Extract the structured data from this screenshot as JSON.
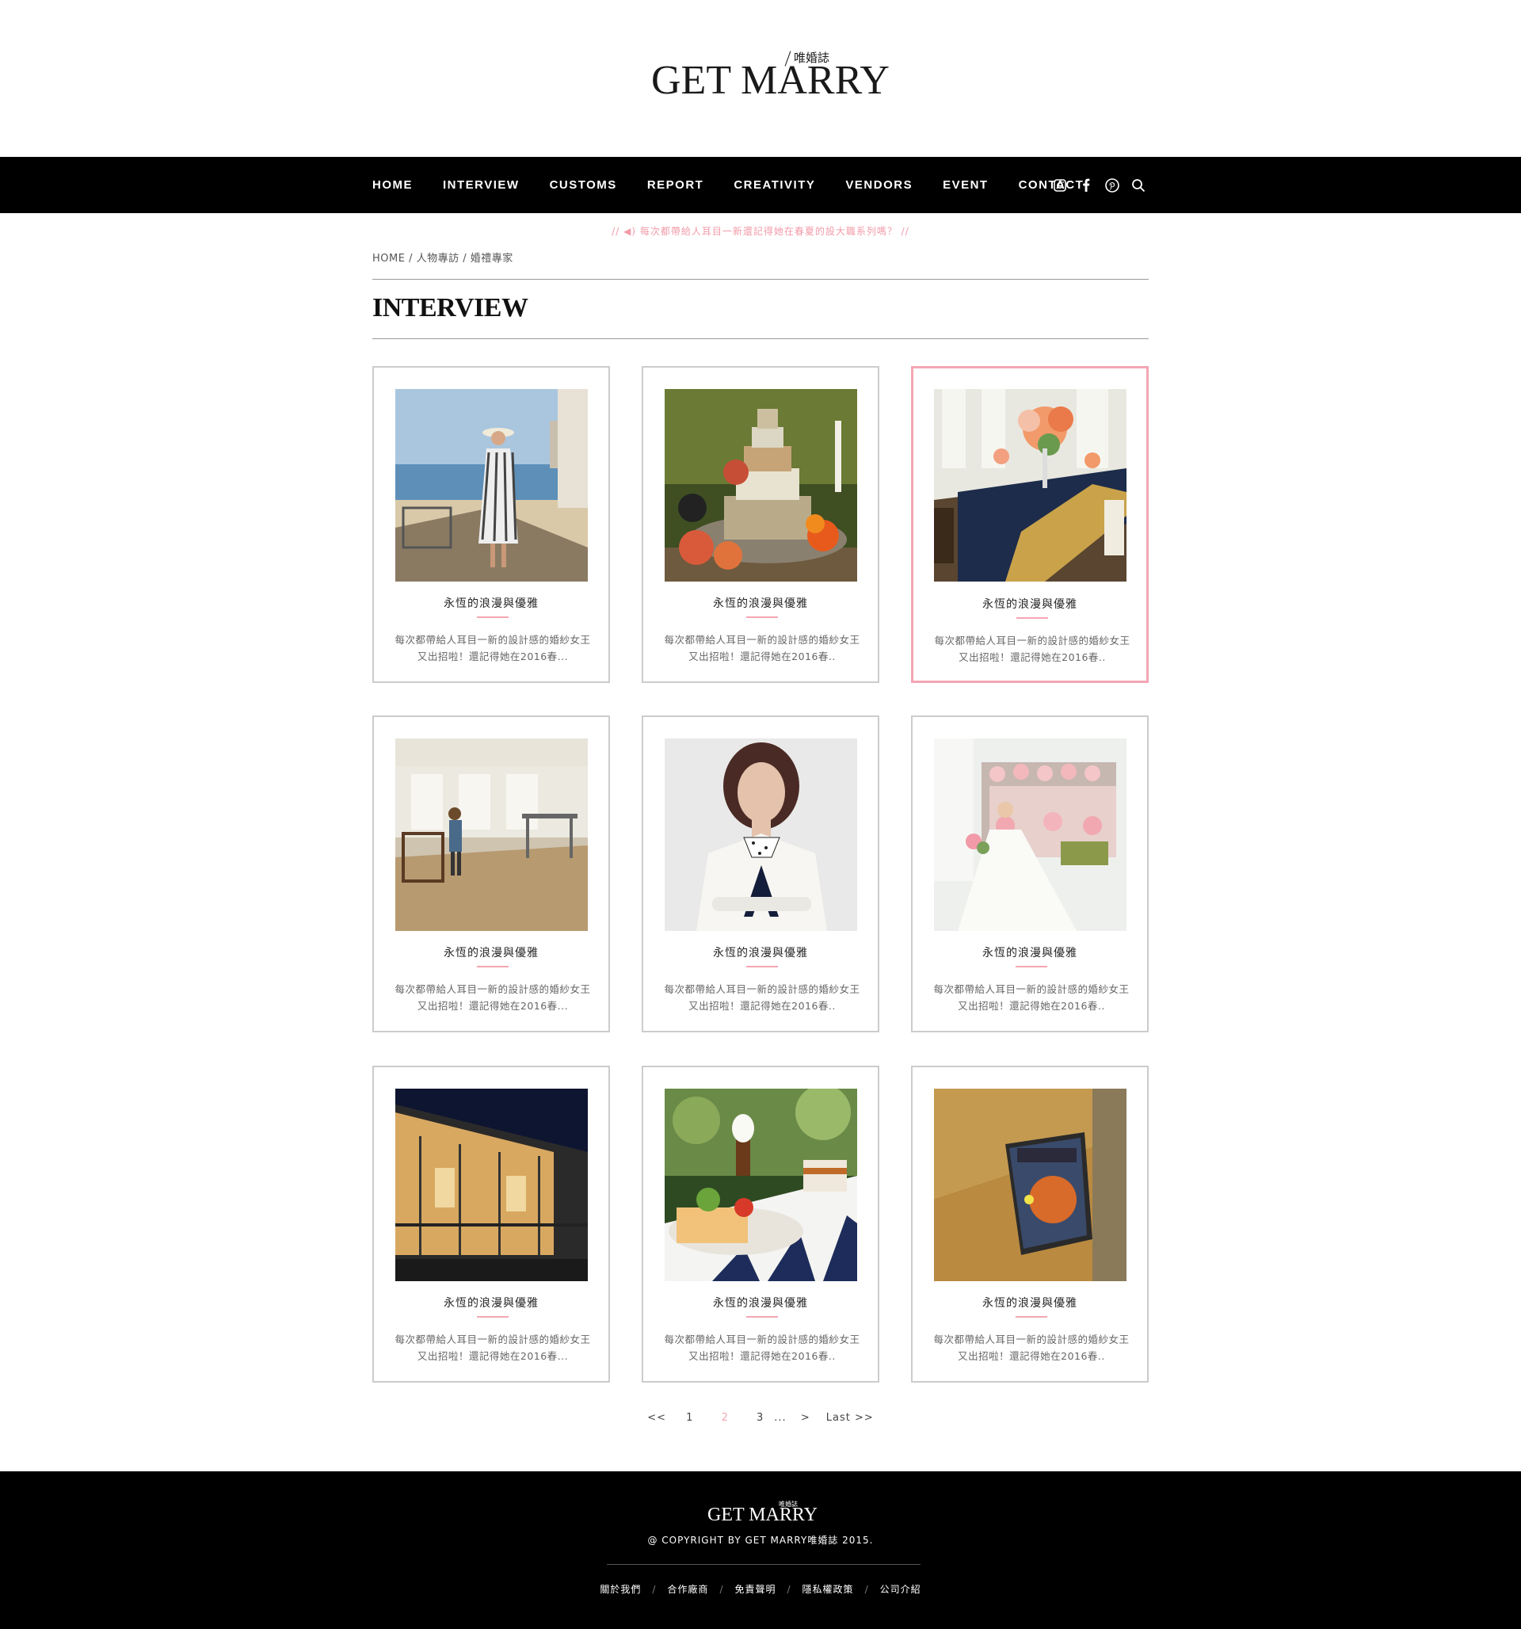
{
  "header": {
    "logo_main": "GET MARRY",
    "logo_sub": "唯婚誌"
  },
  "nav": {
    "items": [
      "HOME",
      "INTERVIEW",
      "CUSTOMS",
      "REPORT",
      "CREATIVITY",
      "VENDORS",
      "EVENT",
      "CONTACT"
    ],
    "icons": [
      "instagram-icon",
      "facebook-icon",
      "pinterest-icon",
      "search-icon"
    ]
  },
  "ticker": "// ◀) 每次都帶給人耳目一新還記得她在春夏的設大職系列嗎？ //",
  "breadcrumb": {
    "home": "HOME",
    "sep": " / ",
    "level1": "人物專訪",
    "level2": "婚禮專家"
  },
  "page_title": "INTERVIEW",
  "cards": [
    {
      "title": "永恆的浪漫與優雅",
      "desc1": "每次都帶給人耳目一新的設計感的婚紗女王",
      "desc2": "又出招啦！還記得她在2016春..."
    },
    {
      "title": "永恆的浪漫與優雅",
      "desc1": "每次都帶給人耳目一新的設計感的婚紗女王",
      "desc2": "又出招啦！還記得她在2016春.."
    },
    {
      "title": "永恆的浪漫與優雅",
      "desc1": "每次都帶給人耳目一新的設計感的婚紗女王",
      "desc2": "又出招啦！還記得她在2016春.."
    },
    {
      "title": "永恆的浪漫與優雅",
      "desc1": "每次都帶給人耳目一新的設計感的婚紗女王",
      "desc2": "又出招啦！還記得她在2016春..."
    },
    {
      "title": "永恆的浪漫與優雅",
      "desc1": "每次都帶給人耳目一新的設計感的婚紗女王",
      "desc2": "又出招啦！還記得她在2016春.."
    },
    {
      "title": "永恆的浪漫與優雅",
      "desc1": "每次都帶給人耳目一新的設計感的婚紗女王",
      "desc2": "又出招啦！還記得她在2016春.."
    },
    {
      "title": "永恆的浪漫與優雅",
      "desc1": "每次都帶給人耳目一新的設計感的婚紗女王",
      "desc2": "又出招啦！還記得她在2016春..."
    },
    {
      "title": "永恆的浪漫與優雅",
      "desc1": "每次都帶給人耳目一新的設計感的婚紗女王",
      "desc2": "又出招啦！還記得她在2016春.."
    },
    {
      "title": "永恆的浪漫與優雅",
      "desc1": "每次都帶給人耳目一新的設計感的婚紗女王",
      "desc2": "又出招啦！還記得她在2016春.."
    }
  ],
  "card_image_names": [
    "woman-seaside-photo",
    "cheese-cake-photo",
    "wedding-table-photo",
    "studio-workspace-photo",
    "woman-portrait-photo",
    "bridal-party-photo",
    "bvlgari-store-photo",
    "breakfast-table-photo",
    "magazine-chair-photo"
  ],
  "active_card": 2,
  "pagination": {
    "first": "<<",
    "pages": [
      "1",
      "2",
      "3"
    ],
    "current": "2",
    "ellipsis": "...",
    "next": ">",
    "last": "Last >>"
  },
  "footer": {
    "logo_main": "GET MARRY",
    "logo_sub": "唯婚誌",
    "copyright": "@ COPYRIGHT BY GET MARRY唯婚誌 2015.",
    "links": [
      "關於我們",
      "合作廠商",
      "免責聲明",
      "隱私權政策",
      "公司介紹"
    ],
    "link_sep": "/"
  },
  "colors": {
    "accent_pink": "#f4a6b3",
    "nav_bg": "#000000",
    "footer_bg": "#000000"
  }
}
